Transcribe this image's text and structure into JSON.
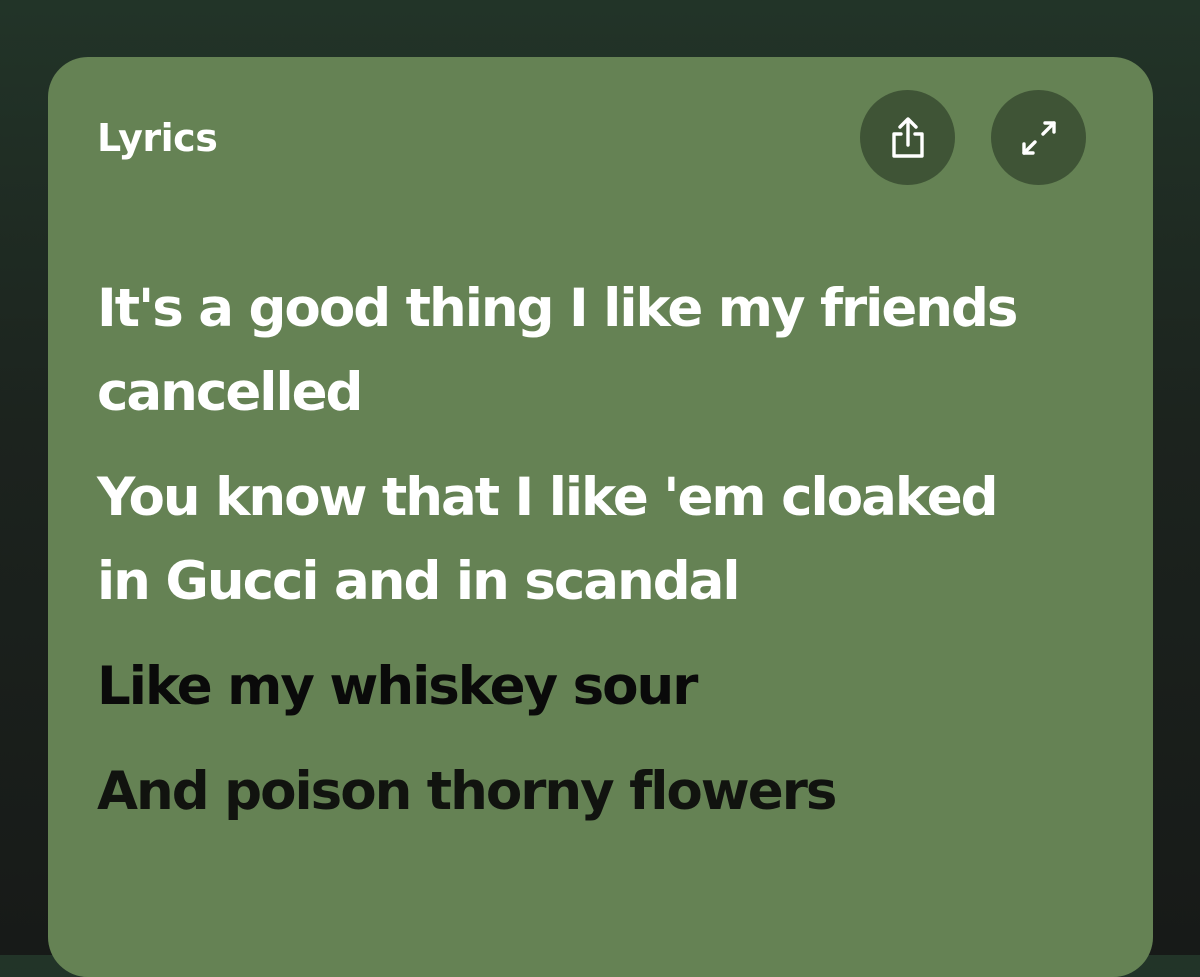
{
  "card": {
    "title": "Lyrics",
    "share_icon": "share-icon",
    "expand_icon": "expand-icon"
  },
  "colors": {
    "background_top": "#223428",
    "background_bottom": "#171a18",
    "card": "#658254",
    "icon_button": "#3f5436",
    "sung_text": "#ffffff",
    "upcoming_text": "#0a0a0a"
  },
  "lyrics": [
    {
      "text": "It's a good thing I like my friends\ncancelled",
      "state": "sung"
    },
    {
      "text": "You know that I like 'em cloaked\nin Gucci and in scandal",
      "state": "sung"
    },
    {
      "text": "Like my whiskey sour",
      "state": "upcoming"
    },
    {
      "text": "And poison thorny flowers",
      "state": "upcoming"
    }
  ]
}
